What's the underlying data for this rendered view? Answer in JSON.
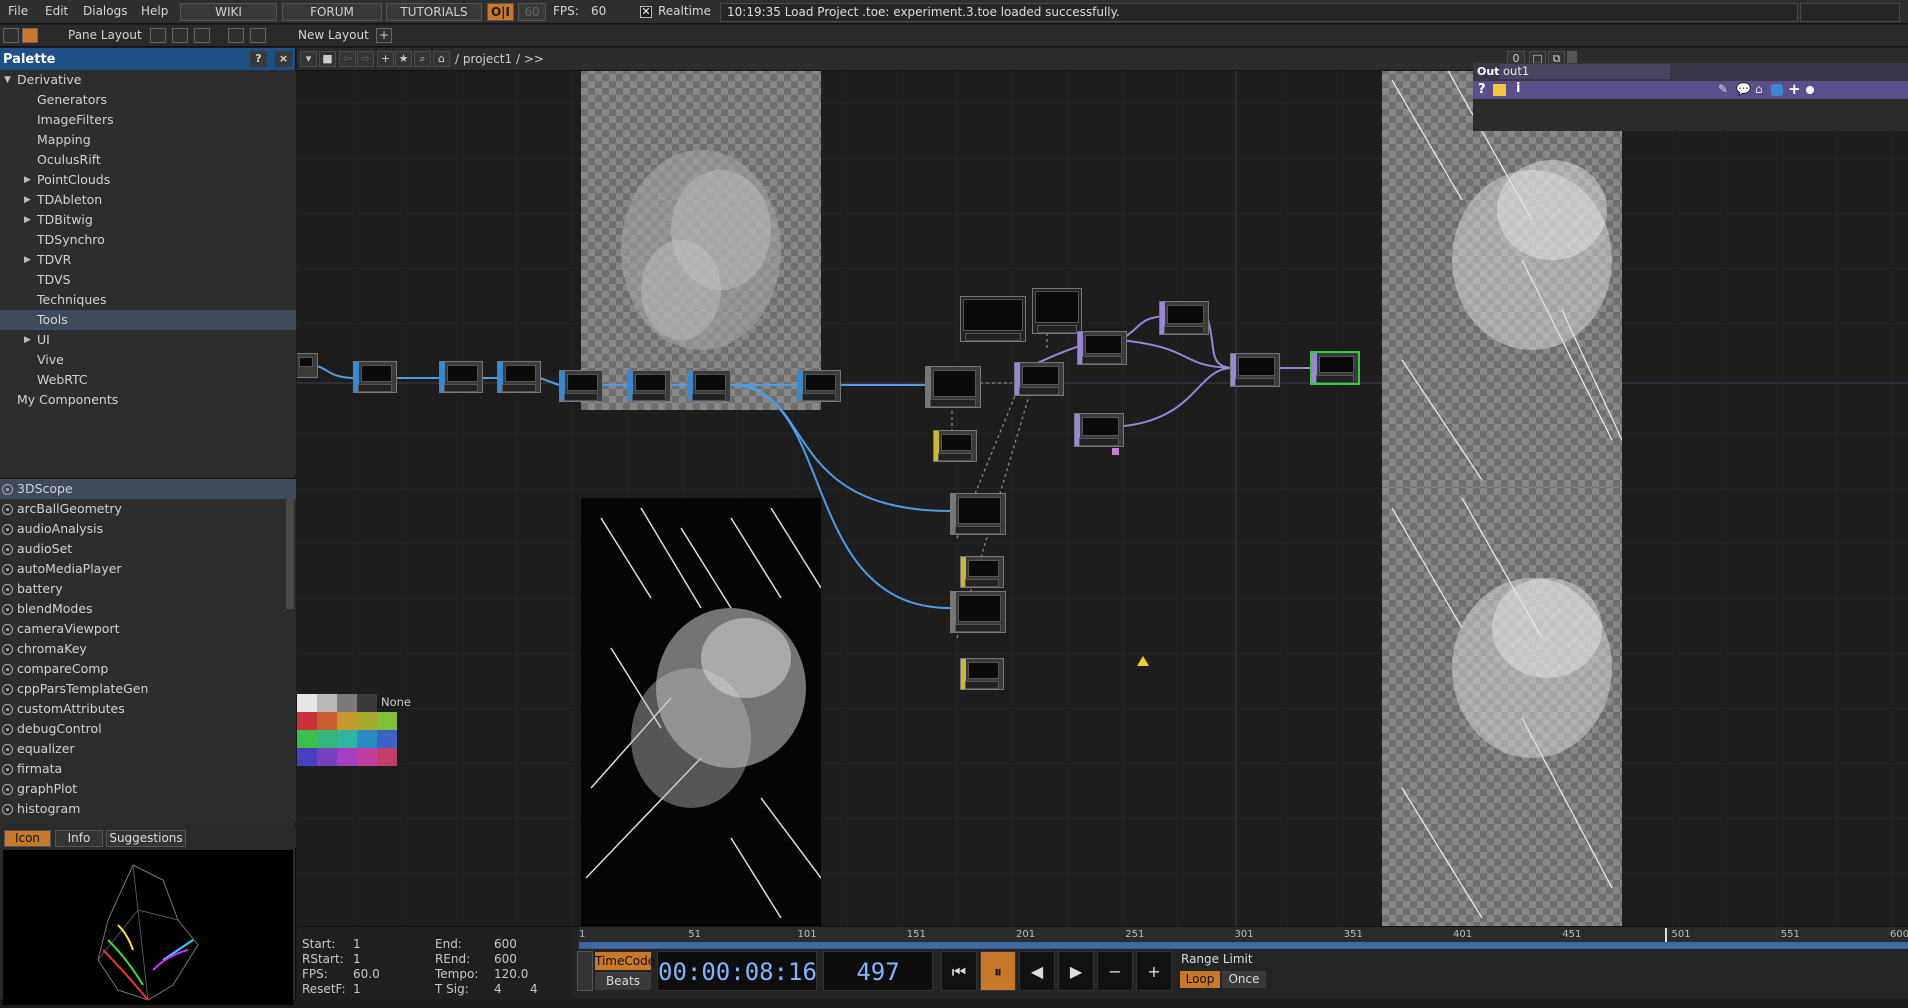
{
  "menu": {
    "file": "File",
    "edit": "Edit",
    "dialogs": "Dialogs",
    "help": "Help",
    "wiki": "WIKI",
    "forum": "FORUM",
    "tutorials": "TUTORIALS",
    "oi": "O|I",
    "fps_cap": "60",
    "fps_label": "FPS:",
    "fps_value": "60",
    "realtime": "Realtime",
    "status": "10:19:35 Load Project .toe: experiment.3.toe loaded successfully."
  },
  "toolbar": {
    "pane_layout": "Pane Layout",
    "new_layout": "New Layout"
  },
  "palette": {
    "title": "Palette",
    "help_btn": "?",
    "close_btn": "×",
    "tree": [
      {
        "label": "Derivative",
        "level": 0,
        "caret": "open"
      },
      {
        "label": "Generators",
        "level": 1,
        "caret": "none"
      },
      {
        "label": "ImageFilters",
        "level": 1,
        "caret": "none"
      },
      {
        "label": "Mapping",
        "level": 1,
        "caret": "none"
      },
      {
        "label": "OculusRift",
        "level": 1,
        "caret": "none"
      },
      {
        "label": "PointClouds",
        "level": 1,
        "caret": "closed"
      },
      {
        "label": "TDAbleton",
        "level": 1,
        "caret": "closed"
      },
      {
        "label": "TDBitwig",
        "level": 1,
        "caret": "closed"
      },
      {
        "label": "TDSynchro",
        "level": 1,
        "caret": "none"
      },
      {
        "label": "TDVR",
        "level": 1,
        "caret": "closed"
      },
      {
        "label": "TDVS",
        "level": 1,
        "caret": "none"
      },
      {
        "label": "Techniques",
        "level": 1,
        "caret": "none"
      },
      {
        "label": "Tools",
        "level": 1,
        "caret": "none",
        "selected": true
      },
      {
        "label": "UI",
        "level": 1,
        "caret": "closed"
      },
      {
        "label": "Vive",
        "level": 1,
        "caret": "none"
      },
      {
        "label": "WebRTC",
        "level": 1,
        "caret": "none"
      },
      {
        "label": "My Components",
        "level": 0,
        "caret": "none"
      }
    ],
    "components": [
      "3DScope",
      "arcBallGeometry",
      "audioAnalysis",
      "audioSet",
      "autoMediaPlayer",
      "battery",
      "blendModes",
      "cameraViewport",
      "chromaKey",
      "compareComp",
      "cppParsTemplateGen",
      "customAttributes",
      "debugControl",
      "equalizer",
      "firmata",
      "graphPlot",
      "histogram"
    ],
    "tabs": {
      "icon": "Icon",
      "info": "Info",
      "suggestions": "Suggestions"
    }
  },
  "network": {
    "path": "/ project1 / >>",
    "zoom_value": "0",
    "color_none": "None",
    "swatch_colors": [
      "#e6e6e6",
      "#b9b9b9",
      "#7a7a7a",
      "#3a3a3a",
      "#c8333a",
      "#c75c2e",
      "#c59a2a",
      "#a7a92c",
      "#7fbf3a",
      "#3bbf4a",
      "#35b47c",
      "#2fb4a4",
      "#2d8cbf",
      "#3a63c5",
      "#4a3fbf",
      "#7a3fbf",
      "#a43fbf",
      "#bf3f9e",
      "#bf3f6a"
    ],
    "out_panel": {
      "label": "Out",
      "name": "out1",
      "help": "?",
      "info": "i"
    }
  },
  "timeline": {
    "start_label": "Start:",
    "start": "1",
    "end_label": "End:",
    "end": "600",
    "rstart_label": "RStart:",
    "rstart": "1",
    "rend_label": "REnd:",
    "rend": "600",
    "fps_label": "FPS:",
    "fps": "60.0",
    "tempo_label": "Tempo:",
    "tempo": "120.0",
    "resetf_label": "ResetF:",
    "resetf": "1",
    "tsig_label": "T Sig:",
    "tsig_a": "4",
    "tsig_b": "4",
    "ticks": [
      "1",
      "51",
      "101",
      "151",
      "201",
      "251",
      "301",
      "351",
      "401",
      "451",
      "501",
      "551",
      "600"
    ],
    "timecode_btn": "TimeCode",
    "beats_btn": "Beats",
    "timecode": "00:00:08:16",
    "frame": "497",
    "range_limit": "Range Limit",
    "loop": "Loop",
    "once": "Once",
    "current_frame_fraction": 0.828
  }
}
